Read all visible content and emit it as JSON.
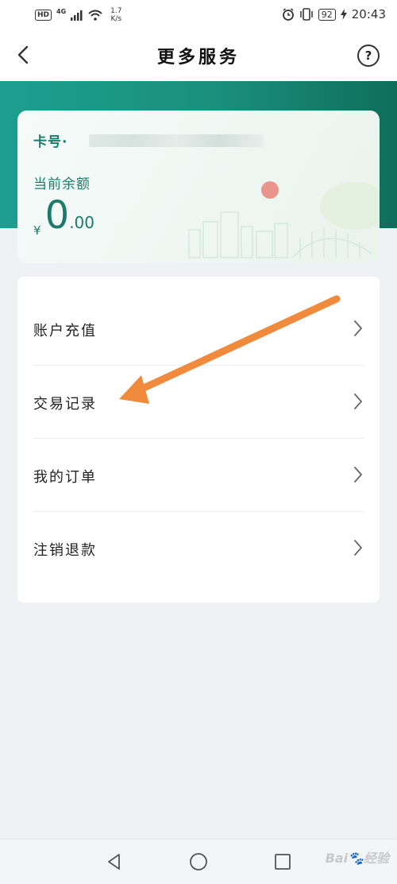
{
  "status_bar": {
    "hd": "HD",
    "network": "4G",
    "speed_value": "1.7",
    "speed_unit": "K/s",
    "battery": "92",
    "time": "20:43"
  },
  "nav": {
    "title": "更多服务",
    "back_icon": "chevron-left-icon",
    "help_icon": "question-circle-icon",
    "help_glyph": "?"
  },
  "card": {
    "card_no_label": "卡号·",
    "balance_label": "当前余额",
    "currency": "¥",
    "amount_int": "0",
    "amount_dec": ".00"
  },
  "menu": {
    "items": [
      {
        "label": "账户充值"
      },
      {
        "label": "交易记录"
      },
      {
        "label": "我的订单"
      },
      {
        "label": "注销退款"
      }
    ]
  },
  "annotation": {
    "color": "#f08a3c"
  },
  "system_nav": {
    "back": "triangle-back-icon",
    "home": "circle-home-icon",
    "recent": "square-recent-icon",
    "watermark": "Bai🐾经验"
  },
  "colors": {
    "accent": "#1c9f8f",
    "accent_dark": "#0e6e5a",
    "text_green": "#1c7a6a"
  }
}
